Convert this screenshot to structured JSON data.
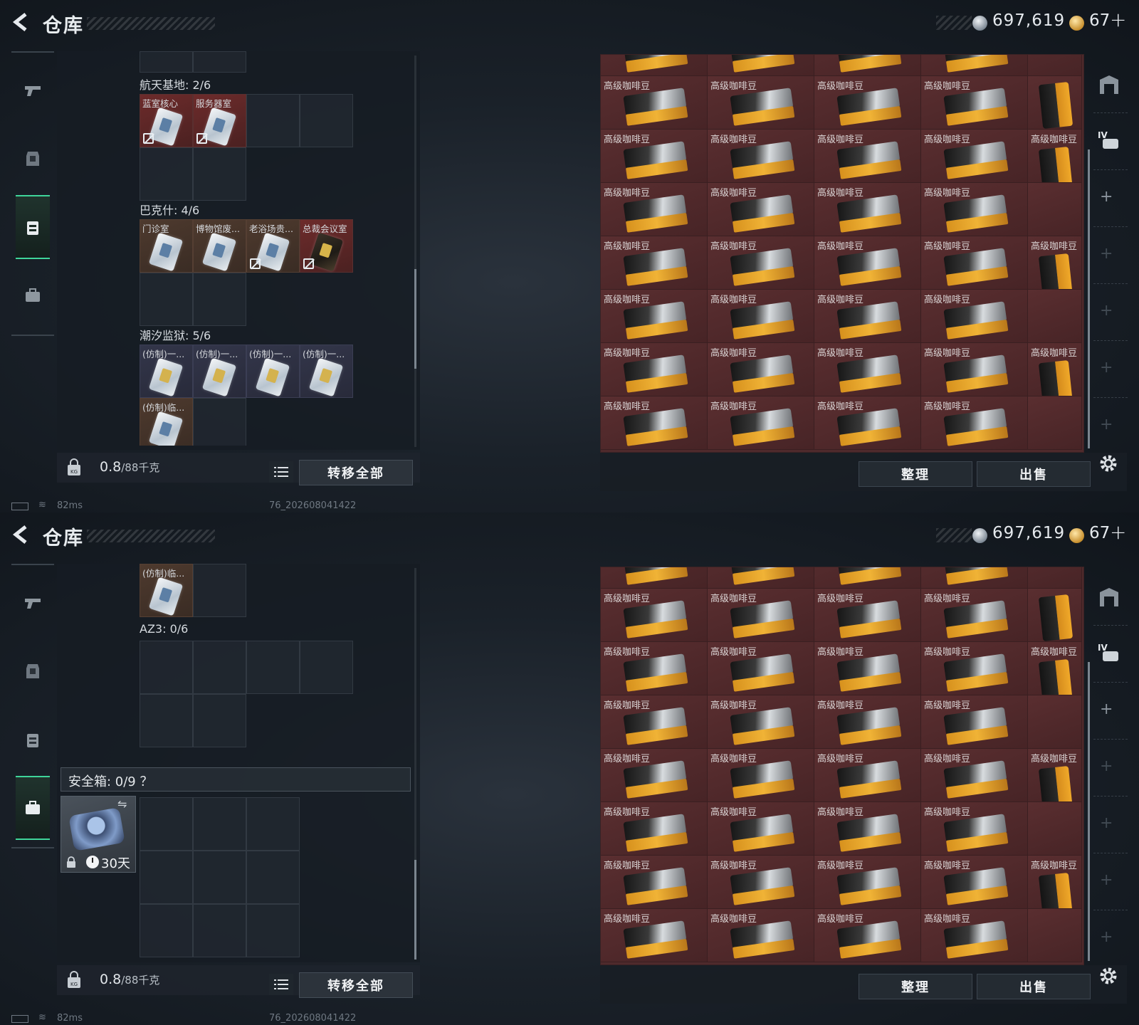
{
  "header": {
    "title": "仓库",
    "silver_amount": "697,619",
    "gold_amount": "67",
    "gold_plus": "+"
  },
  "left": {
    "weight_value": "0.8",
    "weight_max": "/88千克",
    "transfer_label": "转移全部"
  },
  "status": {
    "ping": "82ms",
    "build": "76_202608041422"
  },
  "right": {
    "item_name": "高级咖啡豆",
    "sort_label": "整理",
    "sell_label": "出售"
  },
  "screen1": {
    "sections": [
      {
        "title": "航天基地: 2/6",
        "slots": [
          "蓝室核心",
          "服务器室"
        ]
      },
      {
        "title": "巴克什: 4/6",
        "slots": [
          "门诊室",
          "博物馆废...",
          "老浴场贵...",
          "总裁会议室"
        ]
      },
      {
        "title": "潮汐监狱: 5/6",
        "slots": [
          "(仿制)一...",
          "(仿制)一...",
          "(仿制)一...",
          "(仿制)一...",
          "(仿制)临..."
        ]
      }
    ]
  },
  "screen2": {
    "top_slot": "(仿制)临...",
    "az3_title": "AZ3: 0/6",
    "safe_title": "安全箱: 0/9 ？",
    "safe_days": "30天"
  },
  "colors": {
    "accent_green": "#3fd59a",
    "item_red": "#4f2a2c",
    "coffee_orange": "#f0b336"
  }
}
